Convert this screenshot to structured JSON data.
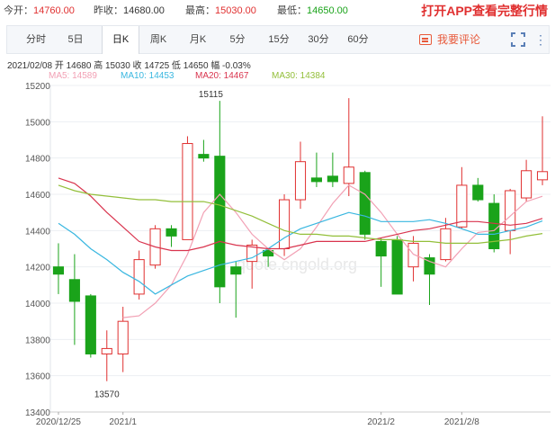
{
  "quote": {
    "open_label": "今开：",
    "open_value": "14760.00",
    "prev_close_label": "昨收：",
    "prev_close_value": "14680.00",
    "high_label": "最高：",
    "high_value": "15030.00",
    "low_label": "最低：",
    "low_value": "14650.00",
    "app_cta": "打开APP查看完整行情"
  },
  "tabs": [
    "分时",
    "5日",
    "日K",
    "周K",
    "月K",
    "5分",
    "15分",
    "30分",
    "60分"
  ],
  "active_tab": "日K",
  "comment_label": "我要评论",
  "info": "2021/02/08  开 14680  高 15030  收 14725  低 14650  幅 -0.03%",
  "ma": {
    "ma5": "MA5: 14589",
    "ma10": "MA10: 14453",
    "ma20": "MA20: 14467",
    "ma30": "MA30: 14384"
  },
  "colors": {
    "up": "#e03030",
    "down": "#1aa31a",
    "ma5": "#f2a0b4",
    "ma10": "#39b7e0",
    "ma20": "#d9344e",
    "ma30": "#93bf3a",
    "accent": "#e8593a"
  },
  "chart_data": {
    "type": "candlestick",
    "y_ticks": [
      "15200",
      "15000",
      "14800",
      "14600",
      "14400",
      "14200",
      "14000",
      "13800",
      "13600",
      "13400"
    ],
    "ylim": [
      13400,
      15200
    ],
    "x_labels": [
      {
        "label": "2020/12/25",
        "index": 0
      },
      {
        "label": "2021/1",
        "index": 4
      },
      {
        "label": "2021/2",
        "index": 20
      },
      {
        "label": "2021/2/8",
        "index": 25
      }
    ],
    "annotations": [
      {
        "text": "15115",
        "index": 9,
        "value": 15115
      },
      {
        "text": "13570",
        "index": 3,
        "value": 13570
      }
    ],
    "watermark": "quote.cngold.org",
    "candles": [
      {
        "o": 14200,
        "c": 14160,
        "h": 14330,
        "l": 14050
      },
      {
        "o": 14130,
        "c": 14010,
        "h": 14270,
        "l": 13770
      },
      {
        "o": 14040,
        "c": 13720,
        "h": 14050,
        "l": 13700
      },
      {
        "o": 13720,
        "c": 13750,
        "h": 13850,
        "l": 13570
      },
      {
        "o": 13720,
        "c": 13900,
        "h": 13980,
        "l": 13620
      },
      {
        "o": 14050,
        "c": 14240,
        "h": 14290,
        "l": 14020
      },
      {
        "o": 14210,
        "c": 14410,
        "h": 14430,
        "l": 14190
      },
      {
        "o": 14410,
        "c": 14370,
        "h": 14430,
        "l": 14310
      },
      {
        "o": 14350,
        "c": 14880,
        "h": 14920,
        "l": 14350
      },
      {
        "o": 14820,
        "c": 14800,
        "h": 14900,
        "l": 14780
      },
      {
        "o": 14810,
        "c": 14090,
        "h": 15115,
        "l": 14000
      },
      {
        "o": 14200,
        "c": 14160,
        "h": 14230,
        "l": 13920
      },
      {
        "o": 14230,
        "c": 14320,
        "h": 14350,
        "l": 14080
      },
      {
        "o": 14290,
        "c": 14260,
        "h": 14300,
        "l": 14200
      },
      {
        "o": 14300,
        "c": 14570,
        "h": 14600,
        "l": 14260
      },
      {
        "o": 14570,
        "c": 14780,
        "h": 14890,
        "l": 14520
      },
      {
        "o": 14690,
        "c": 14670,
        "h": 14830,
        "l": 14640
      },
      {
        "o": 14700,
        "c": 14670,
        "h": 14830,
        "l": 14640
      },
      {
        "o": 14660,
        "c": 14750,
        "h": 15130,
        "l": 14590
      },
      {
        "o": 14720,
        "c": 14380,
        "h": 14730,
        "l": 14350
      },
      {
        "o": 14340,
        "c": 14260,
        "h": 14360,
        "l": 14090
      },
      {
        "o": 14350,
        "c": 14050,
        "h": 14370,
        "l": 14050
      },
      {
        "o": 14200,
        "c": 14330,
        "h": 14370,
        "l": 14120
      },
      {
        "o": 14250,
        "c": 14160,
        "h": 14270,
        "l": 13990
      },
      {
        "o": 14240,
        "c": 14410,
        "h": 14470,
        "l": 14230
      },
      {
        "o": 14420,
        "c": 14650,
        "h": 14750,
        "l": 14410
      },
      {
        "o": 14650,
        "c": 14570,
        "h": 14690,
        "l": 14560
      },
      {
        "o": 14550,
        "c": 14300,
        "h": 14600,
        "l": 14280
      },
      {
        "o": 14400,
        "c": 14620,
        "h": 14630,
        "l": 14270
      },
      {
        "o": 14580,
        "c": 14730,
        "h": 14790,
        "l": 14560
      },
      {
        "o": 14680,
        "c": 14725,
        "h": 15030,
        "l": 14650
      }
    ],
    "series": [
      {
        "name": "MA5",
        "values": [
          null,
          null,
          null,
          null,
          13920,
          13930,
          14000,
          14100,
          14270,
          14500,
          14600,
          14500,
          14380,
          14300,
          14240,
          14300,
          14420,
          14550,
          14650,
          14600,
          14500,
          14380,
          14270,
          14230,
          14200,
          14300,
          14390,
          14400,
          14480,
          14560,
          14589
        ]
      },
      {
        "name": "MA10",
        "values": [
          14440,
          14380,
          14300,
          14240,
          14170,
          14120,
          14050,
          14100,
          14150,
          14180,
          14210,
          14230,
          14250,
          14300,
          14360,
          14410,
          14440,
          14470,
          14500,
          14480,
          14450,
          14450,
          14450,
          14460,
          14440,
          14410,
          14380,
          14380,
          14400,
          14420,
          14453
        ]
      },
      {
        "name": "MA20",
        "values": [
          14690,
          14660,
          14590,
          14500,
          14420,
          14340,
          14310,
          14290,
          14290,
          14310,
          14340,
          14320,
          14310,
          14300,
          14300,
          14320,
          14340,
          14340,
          14340,
          14340,
          14360,
          14380,
          14400,
          14410,
          14430,
          14450,
          14450,
          14440,
          14430,
          14440,
          14467
        ]
      },
      {
        "name": "MA30",
        "values": [
          14650,
          14620,
          14600,
          14590,
          14580,
          14570,
          14570,
          14560,
          14560,
          14560,
          14540,
          14510,
          14480,
          14440,
          14400,
          14380,
          14380,
          14370,
          14370,
          14360,
          14350,
          14350,
          14340,
          14340,
          14330,
          14330,
          14330,
          14340,
          14350,
          14370,
          14384
        ]
      }
    ]
  }
}
